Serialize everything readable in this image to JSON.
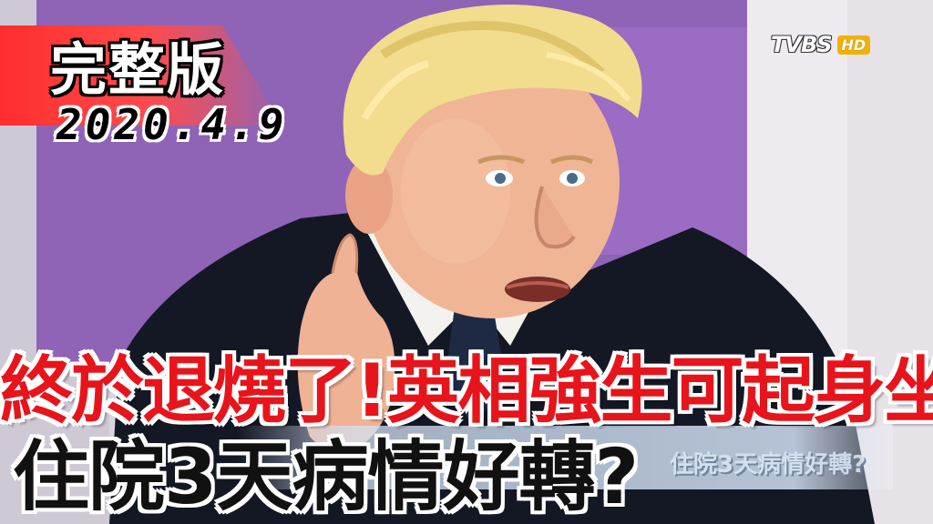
{
  "badge": {
    "label": "完整版",
    "date": "2020.4.9"
  },
  "channel": {
    "logo_text": "TVBS",
    "hd_text": "HD"
  },
  "headline": {
    "line1": "終於退燒了!英相強生可起身坐著",
    "line2": "住院3天病情好轉?"
  },
  "background_caption": "住院3天病情好轉?",
  "colors": {
    "headline_red": "#e8141b",
    "badge_red": "#ff2a2a",
    "hd_gold": "#f2b100",
    "backdrop_purple": "#8f63b6"
  }
}
